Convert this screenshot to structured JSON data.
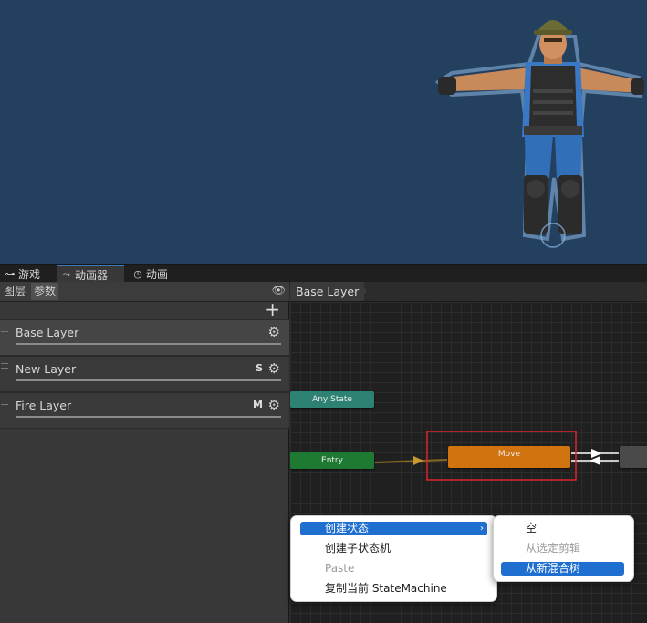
{
  "tabs": [
    {
      "icon": "gamepad-icon",
      "label": "游戏"
    },
    {
      "icon": "animator-icon",
      "label": "动画器"
    },
    {
      "icon": "clock-icon",
      "label": "动画"
    }
  ],
  "left_panel": {
    "subtabs": [
      "图层",
      "参数"
    ],
    "eye_icon": "eye-icon",
    "add_icon": "plus-icon",
    "layers": [
      {
        "name": "Base Layer",
        "badge": ""
      },
      {
        "name": "New Layer",
        "badge": "S"
      },
      {
        "name": "Fire Layer",
        "badge": "M"
      }
    ]
  },
  "graph": {
    "breadcrumb": "Base Layer",
    "nodes": {
      "any_state": "Any State",
      "entry": "Entry",
      "move": "Move"
    },
    "colors": {
      "any_state": "#2e8273",
      "entry": "#1e7a32",
      "move": "#d1730f",
      "selection": "#e0232a"
    }
  },
  "context_menu": {
    "items": [
      {
        "label": "创建状态",
        "highlighted": true,
        "has_submenu": true
      },
      {
        "label": "创建子状态机"
      },
      {
        "label": "Paste",
        "disabled": true
      },
      {
        "label": "复制当前 StateMachine"
      }
    ],
    "submenu": [
      {
        "label": "空"
      },
      {
        "label": "从选定剪辑",
        "disabled": true
      },
      {
        "label": "从新混合树",
        "highlighted": true
      }
    ]
  }
}
